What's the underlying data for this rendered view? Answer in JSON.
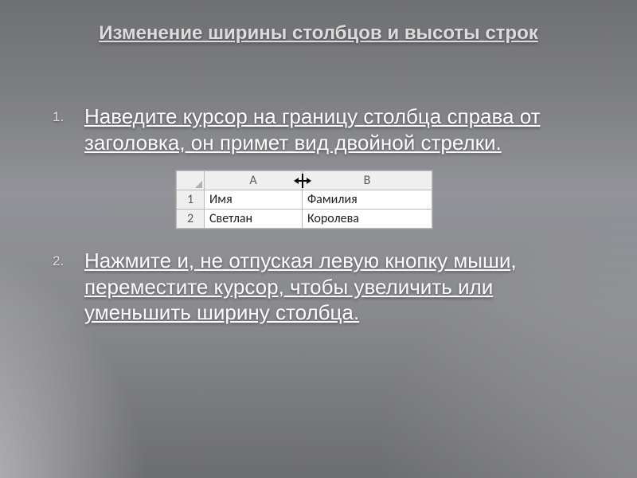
{
  "title": "Изменение ширины столбцов и высоты строк",
  "list": {
    "item1": "Наведите курсор на границу столбца справа от заголовка, он примет вид двойной стрелки.",
    "item2": "Нажмите и, не отпуская левую кнопку мыши, переместите курсор, чтобы увеличить или уменьшить ширину столбца."
  },
  "excel": {
    "colA": "A",
    "colB": "B",
    "row1": "1",
    "row2": "2",
    "r1c1": "Имя",
    "r1c2": "Фамилия",
    "r2c1": "Светлан",
    "r2c2": "Королева"
  }
}
